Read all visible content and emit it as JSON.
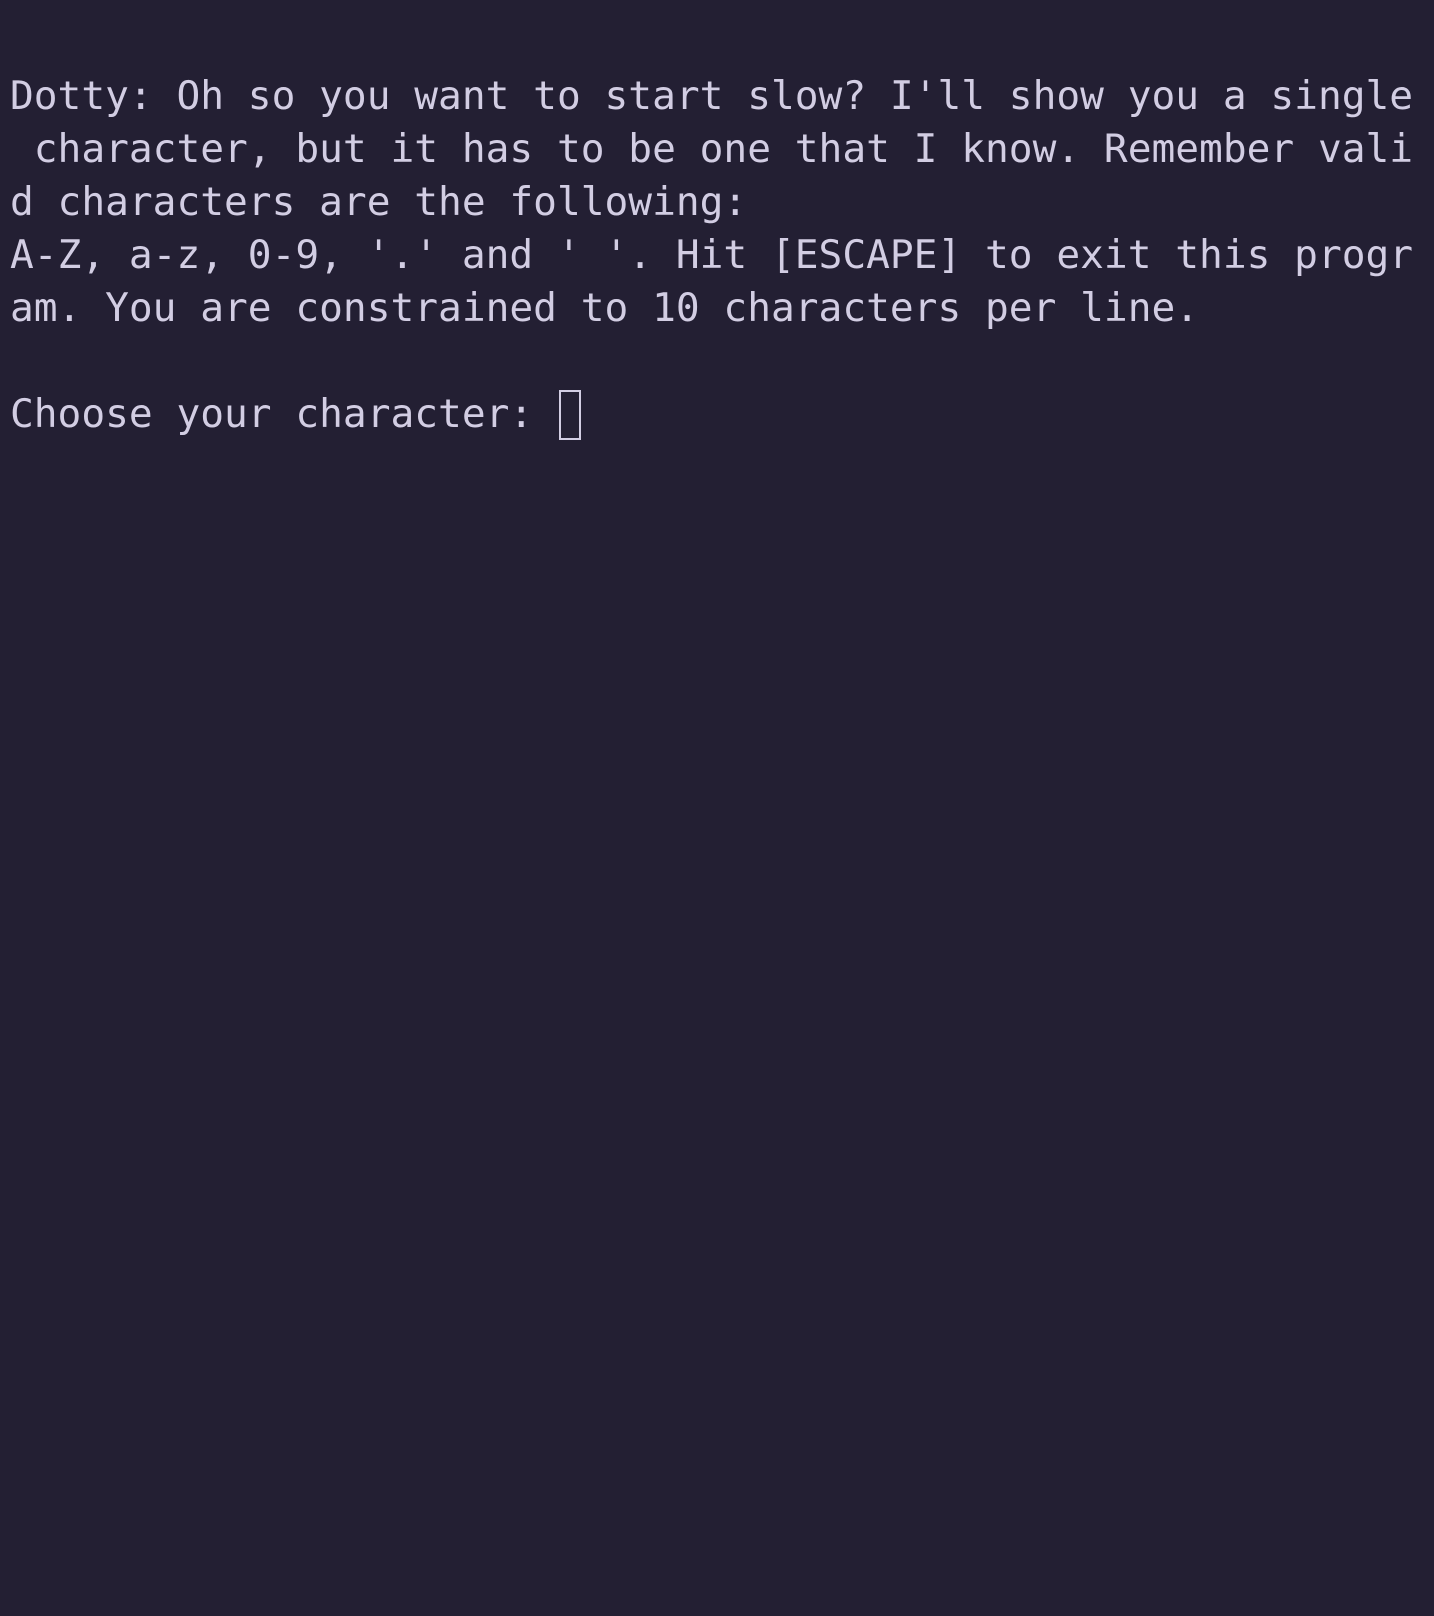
{
  "terminal": {
    "lines": [
      "Dotty: Oh so you want to start slow? I'll show you a single",
      " character, but it has to be one that I know. Remember vali",
      "d characters are the following:",
      "A-Z, a-z, 0-9, '.' and ' '. Hit [ESCAPE] to exit this progr",
      "am. You are constrained to 10 characters per line."
    ],
    "prompt": "Choose your character:",
    "input_value": "",
    "colors": {
      "background": "#231f33",
      "text": "#d2cde3"
    }
  }
}
